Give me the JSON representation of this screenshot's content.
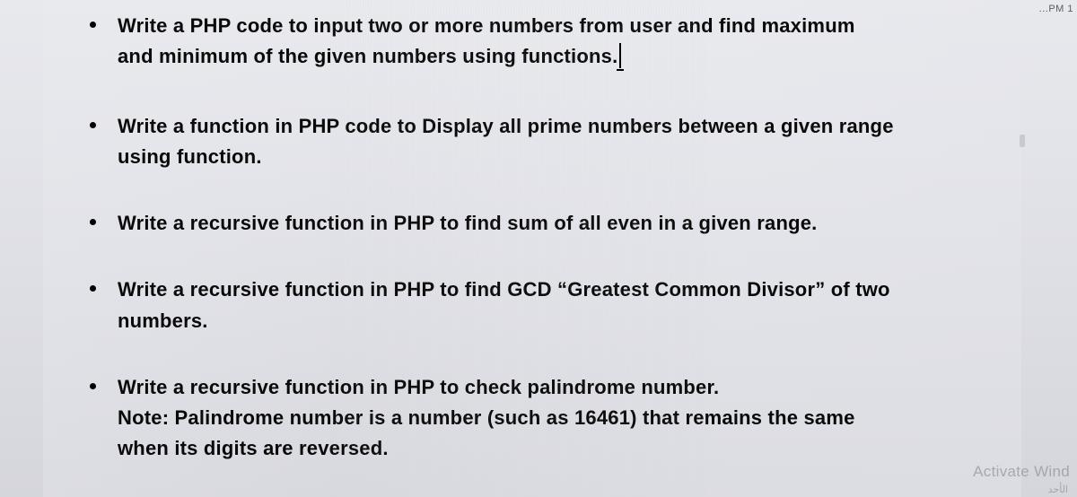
{
  "corner": "...PM 1",
  "items": [
    {
      "text": "Write a PHP code to input two or more numbers from user and find maximum and minimum of the given numbers using functions.",
      "has_cursor": true
    },
    {
      "text": "Write a function in PHP code to Display all prime numbers between a given range using function."
    },
    {
      "text": "Write a recursive function in PHP to find sum of all even in a given range."
    },
    {
      "text": "Write a recursive function in PHP to find GCD “Greatest Common Divisor” of two numbers."
    },
    {
      "text": "Write a recursive function in PHP to check palindrome number.",
      "note": "Note: Palindrome number is a number (such as 16461) that remains the same when its digits are reversed."
    }
  ],
  "watermark": "Activate Wind",
  "bottom_tag": "الأحد"
}
